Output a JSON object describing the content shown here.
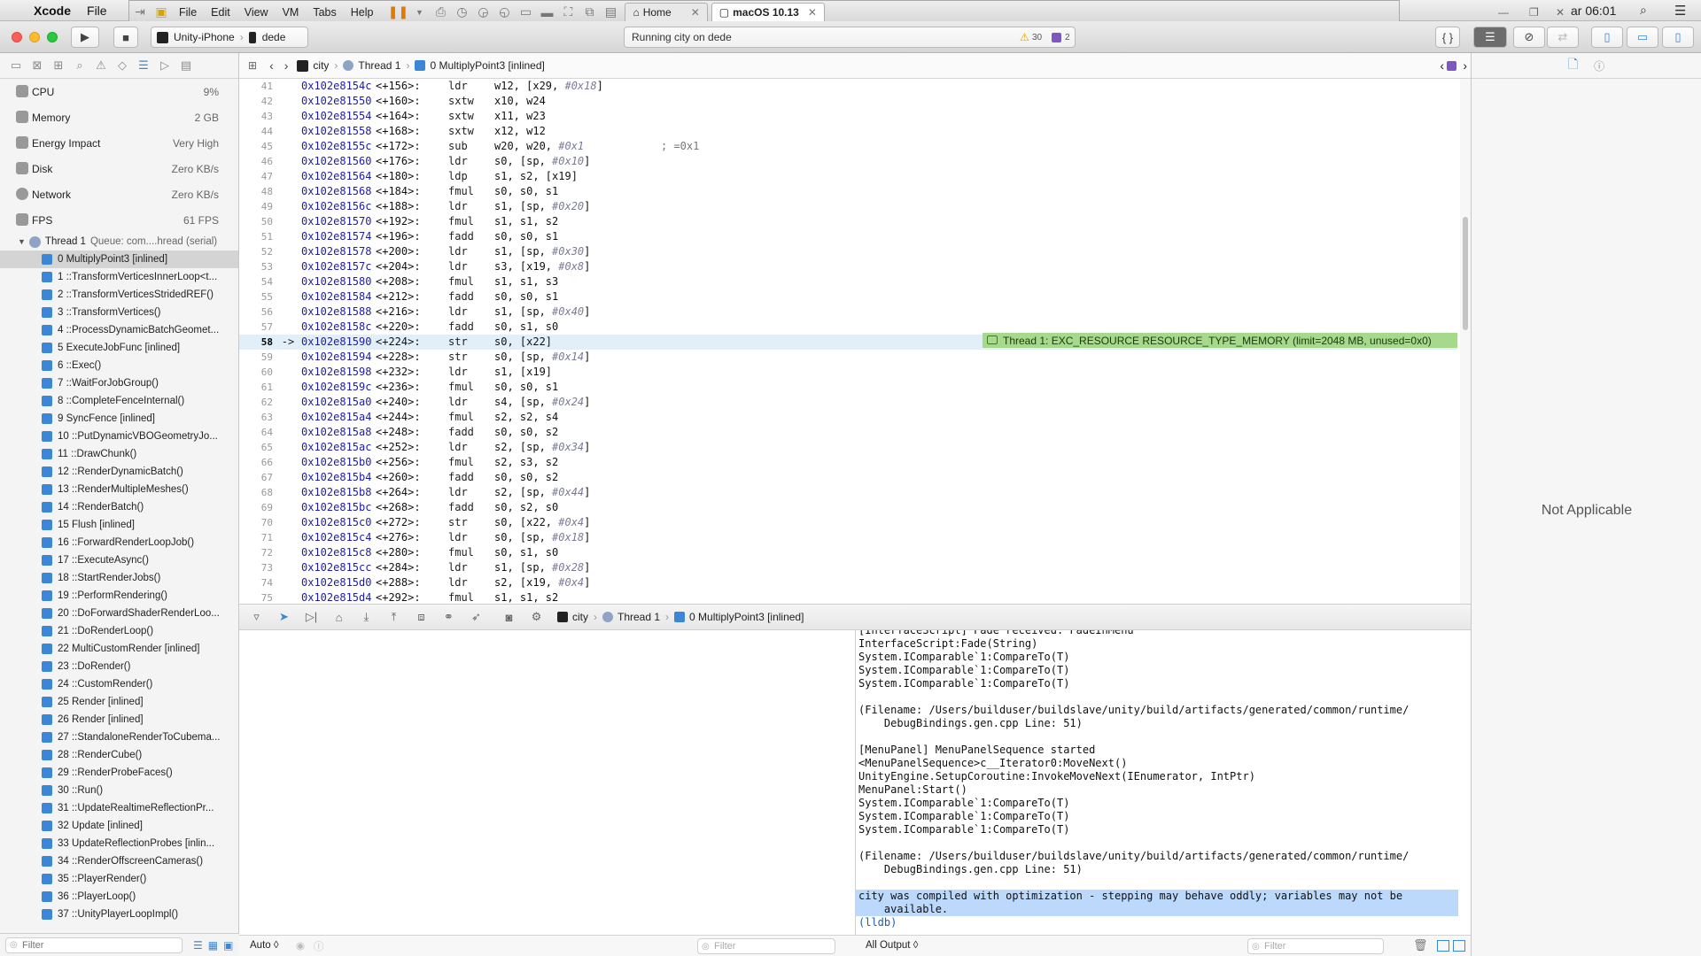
{
  "menubar": {
    "app": "Xcode",
    "items": [
      "File"
    ],
    "clock": "ar 06:01"
  },
  "vm": {
    "menus": [
      "File",
      "Edit",
      "View",
      "VM",
      "Tabs",
      "Help"
    ],
    "tabs": [
      {
        "label": "Home",
        "active": false
      },
      {
        "label": "macOS 10.13",
        "active": true
      }
    ]
  },
  "toolbar": {
    "scheme": "Unity-iPhone",
    "device": "dede",
    "activity": "Running city on dede",
    "warnings": "30",
    "issues": "2"
  },
  "jumpbar": {
    "crumbs": [
      "city",
      "Thread 1",
      "0 MultiplyPoint3 [inlined]"
    ]
  },
  "navigator": {
    "gauges": [
      {
        "label": "CPU",
        "value": "9%"
      },
      {
        "label": "Memory",
        "value": "2 GB"
      },
      {
        "label": "Energy Impact",
        "value": "Very High"
      },
      {
        "label": "Disk",
        "value": "Zero KB/s"
      },
      {
        "label": "Network",
        "value": "Zero KB/s"
      },
      {
        "label": "FPS",
        "value": "61 FPS"
      }
    ],
    "thread": {
      "label": "Thread 1",
      "queue": "Queue: com....hread (serial)"
    },
    "frames": [
      "0 MultiplyPoint3 [inlined]",
      "1 ::TransformVerticesInnerLoop<t...",
      "2 ::TransformVerticesStridedREF()",
      "3 ::TransformVertices()",
      "4 ::ProcessDynamicBatchGeomet...",
      "5 ExecuteJobFunc [inlined]",
      "6 ::Exec()",
      "7 ::WaitForJobGroup()",
      "8 ::CompleteFenceInternal()",
      "9 SyncFence [inlined]",
      "10 ::PutDynamicVBOGeometryJo...",
      "11 ::DrawChunk()",
      "12 ::RenderDynamicBatch()",
      "13 ::RenderMultipleMeshes()",
      "14 ::RenderBatch()",
      "15 Flush [inlined]",
      "16 ::ForwardRenderLoopJob()",
      "17 ::ExecuteAsync()",
      "18 ::StartRenderJobs()",
      "19 ::PerformRendering()",
      "20 ::DoForwardShaderRenderLoo...",
      "21 ::DoRenderLoop()",
      "22 MultiCustomRender [inlined]",
      "23 ::DoRender()",
      "24 ::CustomRender()",
      "25 Render [inlined]",
      "26 Render [inlined]",
      "27 ::StandaloneRenderToCubema...",
      "28 ::RenderCube()",
      "29 ::RenderProbeFaces()",
      "30 ::Run()",
      "31 ::UpdateRealtimeReflectionPr...",
      "32 Update [inlined]",
      "33 UpdateReflectionProbes [inlin...",
      "34 ::RenderOffscreenCameras()",
      "35 ::PlayerRender()",
      "36 ::PlayerLoop()",
      "37 ::UnityPlayerLoopImpl()"
    ],
    "filter_placeholder": "Filter"
  },
  "editor": {
    "lines": [
      {
        "n": "41",
        "addr": "0x102e8154c",
        "off": "<+156>:",
        "op": "ldr",
        "args": "w12, [x29, ",
        "imm": "#0x18",
        "tail": "]"
      },
      {
        "n": "42",
        "addr": "0x102e81550",
        "off": "<+160>:",
        "op": "sxtw",
        "args": "x10, w24",
        "imm": "",
        "tail": ""
      },
      {
        "n": "43",
        "addr": "0x102e81554",
        "off": "<+164>:",
        "op": "sxtw",
        "args": "x11, w23",
        "imm": "",
        "tail": ""
      },
      {
        "n": "44",
        "addr": "0x102e81558",
        "off": "<+168>:",
        "op": "sxtw",
        "args": "x12, w12",
        "imm": "",
        "tail": ""
      },
      {
        "n": "45",
        "addr": "0x102e8155c",
        "off": "<+172>:",
        "op": "sub",
        "args": "w20, w20, ",
        "imm": "#0x1",
        "tail": "",
        "comment": "; =0x1"
      },
      {
        "n": "46",
        "addr": "0x102e81560",
        "off": "<+176>:",
        "op": "ldr",
        "args": "s0, [sp, ",
        "imm": "#0x10",
        "tail": "]"
      },
      {
        "n": "47",
        "addr": "0x102e81564",
        "off": "<+180>:",
        "op": "ldp",
        "args": "s1, s2, [x19]",
        "imm": "",
        "tail": ""
      },
      {
        "n": "48",
        "addr": "0x102e81568",
        "off": "<+184>:",
        "op": "fmul",
        "args": "s0, s0, s1",
        "imm": "",
        "tail": ""
      },
      {
        "n": "49",
        "addr": "0x102e8156c",
        "off": "<+188>:",
        "op": "ldr",
        "args": "s1, [sp, ",
        "imm": "#0x20",
        "tail": "]"
      },
      {
        "n": "50",
        "addr": "0x102e81570",
        "off": "<+192>:",
        "op": "fmul",
        "args": "s1, s1, s2",
        "imm": "",
        "tail": ""
      },
      {
        "n": "51",
        "addr": "0x102e81574",
        "off": "<+196>:",
        "op": "fadd",
        "args": "s0, s0, s1",
        "imm": "",
        "tail": ""
      },
      {
        "n": "52",
        "addr": "0x102e81578",
        "off": "<+200>:",
        "op": "ldr",
        "args": "s1, [sp, ",
        "imm": "#0x30",
        "tail": "]"
      },
      {
        "n": "53",
        "addr": "0x102e8157c",
        "off": "<+204>:",
        "op": "ldr",
        "args": "s3, [x19, ",
        "imm": "#0x8",
        "tail": "]"
      },
      {
        "n": "54",
        "addr": "0x102e81580",
        "off": "<+208>:",
        "op": "fmul",
        "args": "s1, s1, s3",
        "imm": "",
        "tail": ""
      },
      {
        "n": "55",
        "addr": "0x102e81584",
        "off": "<+212>:",
        "op": "fadd",
        "args": "s0, s0, s1",
        "imm": "",
        "tail": ""
      },
      {
        "n": "56",
        "addr": "0x102e81588",
        "off": "<+216>:",
        "op": "ldr",
        "args": "s1, [sp, ",
        "imm": "#0x40",
        "tail": "]"
      },
      {
        "n": "57",
        "addr": "0x102e8158c",
        "off": "<+220>:",
        "op": "fadd",
        "args": "s0, s1, s0",
        "imm": "",
        "tail": ""
      },
      {
        "n": "58",
        "addr": "0x102e81590",
        "off": "<+224>:",
        "op": "str",
        "args": "s0, [x22]",
        "imm": "",
        "tail": "",
        "current": true
      },
      {
        "n": "59",
        "addr": "0x102e81594",
        "off": "<+228>:",
        "op": "str",
        "args": "s0, [sp, ",
        "imm": "#0x14",
        "tail": "]"
      },
      {
        "n": "60",
        "addr": "0x102e81598",
        "off": "<+232>:",
        "op": "ldr",
        "args": "s1, [x19]",
        "imm": "",
        "tail": ""
      },
      {
        "n": "61",
        "addr": "0x102e8159c",
        "off": "<+236>:",
        "op": "fmul",
        "args": "s0, s0, s1",
        "imm": "",
        "tail": ""
      },
      {
        "n": "62",
        "addr": "0x102e815a0",
        "off": "<+240>:",
        "op": "ldr",
        "args": "s4, [sp, ",
        "imm": "#0x24",
        "tail": "]"
      },
      {
        "n": "63",
        "addr": "0x102e815a4",
        "off": "<+244>:",
        "op": "fmul",
        "args": "s2, s2, s4",
        "imm": "",
        "tail": ""
      },
      {
        "n": "64",
        "addr": "0x102e815a8",
        "off": "<+248>:",
        "op": "fadd",
        "args": "s0, s0, s2",
        "imm": "",
        "tail": ""
      },
      {
        "n": "65",
        "addr": "0x102e815ac",
        "off": "<+252>:",
        "op": "ldr",
        "args": "s2, [sp, ",
        "imm": "#0x34",
        "tail": "]"
      },
      {
        "n": "66",
        "addr": "0x102e815b0",
        "off": "<+256>:",
        "op": "fmul",
        "args": "s2, s3, s2",
        "imm": "",
        "tail": ""
      },
      {
        "n": "67",
        "addr": "0x102e815b4",
        "off": "<+260>:",
        "op": "fadd",
        "args": "s0, s0, s2",
        "imm": "",
        "tail": ""
      },
      {
        "n": "68",
        "addr": "0x102e815b8",
        "off": "<+264>:",
        "op": "ldr",
        "args": "s2, [sp, ",
        "imm": "#0x44",
        "tail": "]"
      },
      {
        "n": "69",
        "addr": "0x102e815bc",
        "off": "<+268>:",
        "op": "fadd",
        "args": "s0, s2, s0",
        "imm": "",
        "tail": ""
      },
      {
        "n": "70",
        "addr": "0x102e815c0",
        "off": "<+272>:",
        "op": "str",
        "args": "s0, [x22, ",
        "imm": "#0x4",
        "tail": "]"
      },
      {
        "n": "71",
        "addr": "0x102e815c4",
        "off": "<+276>:",
        "op": "ldr",
        "args": "s0, [sp, ",
        "imm": "#0x18",
        "tail": "]"
      },
      {
        "n": "72",
        "addr": "0x102e815c8",
        "off": "<+280>:",
        "op": "fmul",
        "args": "s0, s1, s0",
        "imm": "",
        "tail": ""
      },
      {
        "n": "73",
        "addr": "0x102e815cc",
        "off": "<+284>:",
        "op": "ldr",
        "args": "s1, [sp, ",
        "imm": "#0x28",
        "tail": "]"
      },
      {
        "n": "74",
        "addr": "0x102e815d0",
        "off": "<+288>:",
        "op": "ldr",
        "args": "s2, [x19, ",
        "imm": "#0x4",
        "tail": "]"
      },
      {
        "n": "75",
        "addr": "0x102e815d4",
        "off": "<+292>:",
        "op": "fmul",
        "args": "s1, s1, s2",
        "imm": "",
        "tail": ""
      }
    ],
    "pc_arrow": "->",
    "exception": "Thread 1: EXC_RESOURCE RESOURCE_TYPE_MEMORY (limit=2048 MB, unused=0x0)"
  },
  "debugbar": {
    "crumbs": [
      "city",
      "Thread 1",
      "0 MultiplyPoint3 [inlined]"
    ]
  },
  "console": {
    "lines": [
      "[InterfaceScript] Fade received: FadeInMenu",
      "InterfaceScript:Fade(String)",
      "System.IComparable`1:CompareTo(T)",
      "System.IComparable`1:CompareTo(T)",
      "System.IComparable`1:CompareTo(T)",
      "",
      "(Filename: /Users/builduser/buildslave/unity/build/artifacts/generated/common/runtime/",
      "    DebugBindings.gen.cpp Line: 51)",
      "",
      "[MenuPanel] MenuPanelSequence started",
      "<MenuPanelSequence>c__Iterator0:MoveNext()",
      "UnityEngine.SetupCoroutine:InvokeMoveNext(IEnumerator, IntPtr)",
      "MenuPanel:Start()",
      "System.IComparable`1:CompareTo(T)",
      "System.IComparable`1:CompareTo(T)",
      "System.IComparable`1:CompareTo(T)",
      "",
      "(Filename: /Users/builduser/buildslave/unity/build/artifacts/generated/common/runtime/",
      "    DebugBindings.gen.cpp Line: 51)",
      ""
    ],
    "highlight": [
      "city was compiled with optimization - stepping may behave oddly; variables may not be",
      "    available."
    ],
    "prompt": "(lldb)"
  },
  "status": {
    "auto": "Auto ◊",
    "filter_placeholder": "Filter",
    "output": "All Output ◊"
  },
  "inspector": {
    "not_applicable": "Not Applicable"
  },
  "colors": {
    "accent": "#3b87d6",
    "exception_bg": "#a6d98b",
    "current_line": "#e2eef8",
    "highlight": "#bcd9fb"
  }
}
